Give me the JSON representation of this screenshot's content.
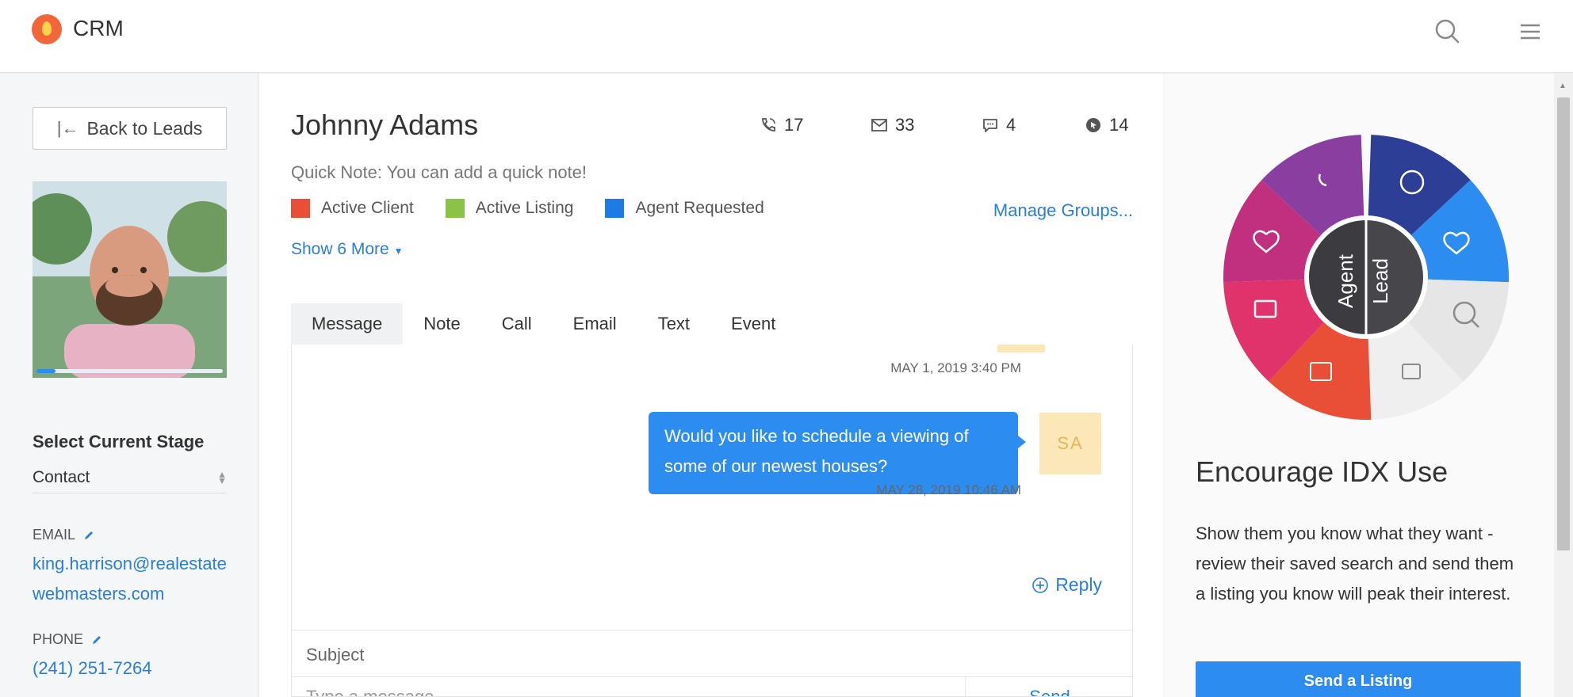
{
  "app": {
    "title": "CRM"
  },
  "sidebar": {
    "back_label": "Back to Leads",
    "photo_progress": 0.1,
    "stage_label": "Select Current Stage",
    "stage_value": "Contact",
    "email_label": "EMAIL",
    "email_value": "king.harrison@realestatewebmasters.com",
    "phone_label": "PHONE",
    "phone_value": "(241) 251-7264"
  },
  "lead": {
    "name": "Johnny Adams",
    "stats": {
      "calls": "17",
      "emails": "33",
      "texts": "4",
      "clicks": "14"
    },
    "quick_note": "Quick Note: You can add a quick note!",
    "groups": [
      {
        "label": "Active Client",
        "color": "#e94f37"
      },
      {
        "label": "Active Listing",
        "color": "#8bc34a"
      },
      {
        "label": "Agent Requested",
        "color": "#1e7be6"
      }
    ],
    "manage_groups": "Manage Groups...",
    "show_more": "Show 6 More"
  },
  "tabs": [
    "Message",
    "Note",
    "Call",
    "Email",
    "Text",
    "Event"
  ],
  "thread": {
    "ts1": "MAY 1, 2019 3:40 PM",
    "message": "Would you like to schedule a viewing of some of our newest houses?",
    "avatar": "SA",
    "ts2": "MAY 28, 2019 10:46 AM",
    "reply": "Reply",
    "subject_placeholder": "Subject",
    "message_placeholder": "Type a message",
    "send": "Send"
  },
  "right": {
    "wheel_agent": "Agent",
    "wheel_lead": "Lead",
    "title": "Encourage IDX Use",
    "text": "Show them you know what they want - review their saved search and send them a listing you know will peak their interest.",
    "button": "Send a Listing"
  },
  "colors": {
    "accent": "#2d8cf0",
    "link": "#2a7fd4"
  }
}
